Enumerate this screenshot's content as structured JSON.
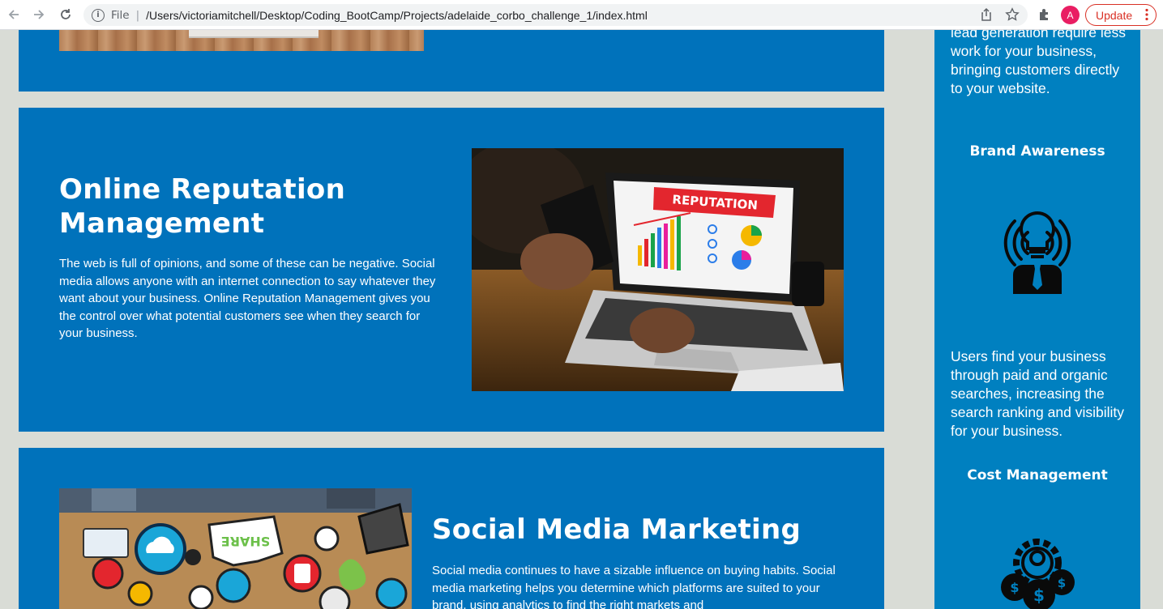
{
  "browser": {
    "file_label": "File",
    "separator": "|",
    "url": "/Users/victoriamitchell/Desktop/Coding_BootCamp/Projects/adelaide_corbo_challenge_1/index.html",
    "avatar_letter": "A",
    "update_label": "Update",
    "icons": [
      "back-arrow-icon",
      "forward-arrow-icon",
      "reload-icon",
      "info-icon",
      "share-icon",
      "star-icon",
      "extensions-icon",
      "menu-dots-icon"
    ]
  },
  "content": {
    "reputation": {
      "title": "Online Reputation Management",
      "body": "The web is full of opinions, and some of these can be negative. Social media allows anyone with an internet connection to say whatever they want about your business. Online Reputation Management gives you the control over what potential customers see when they search for your business.",
      "image_banner": "REPUTATION"
    },
    "social": {
      "title": "Social Media Marketing",
      "body": "Social media continues to have a sizable influence on buying habits. Social media marketing helps you determine which platforms are suited to your brand, using analytics to find the right markets and",
      "image_bubble": "SHARE"
    }
  },
  "sidebar": {
    "top_text": "lead generation require less work for your business, bringing customers directly to your website.",
    "brand_heading": "Brand Awareness",
    "brand_text": "Users find your business through paid and organic searches, increasing the search ranking and visibility for your business.",
    "cost_heading": "Cost Management"
  },
  "colors": {
    "card_bg": "#0072bb",
    "sidebar_bg": "#0080c0",
    "page_bg": "#d9dcd6",
    "update_red": "#d93025"
  }
}
